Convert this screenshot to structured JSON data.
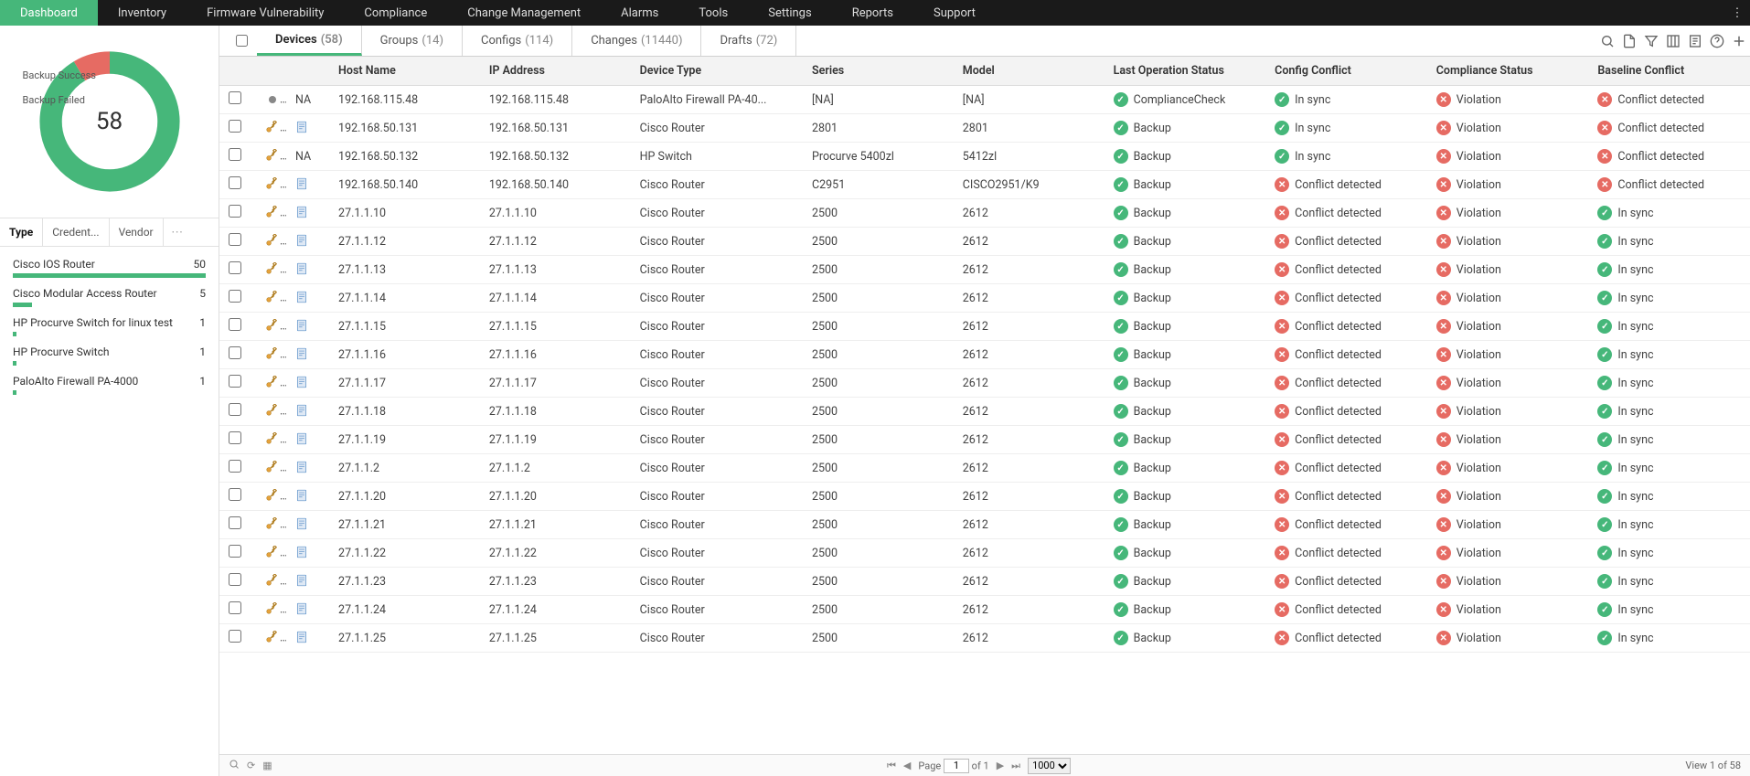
{
  "nav": {
    "items": [
      "Dashboard",
      "Inventory",
      "Firmware Vulnerability",
      "Compliance",
      "Change Management",
      "Alarms",
      "Tools",
      "Settings",
      "Reports",
      "Support"
    ],
    "active": 0
  },
  "chart_data": {
    "type": "pie",
    "title": "",
    "categories": [
      "Backup Success",
      "Backup Failed"
    ],
    "values": [
      53,
      5
    ],
    "colors": [
      "#46b77a",
      "#e66b63"
    ],
    "center_label": "58"
  },
  "sideTabs": {
    "items": [
      "Type",
      "Credent...",
      "Vendor"
    ],
    "active": 0
  },
  "typeList": [
    {
      "label": "Cisco IOS Router",
      "count": 50,
      "pct": 100
    },
    {
      "label": "Cisco Modular Access Router",
      "count": 5,
      "pct": 10
    },
    {
      "label": "HP Procurve Switch for linux test",
      "count": 1,
      "pct": 2
    },
    {
      "label": "HP Procurve Switch",
      "count": 1,
      "pct": 2
    },
    {
      "label": "PaloAlto Firewall PA-4000",
      "count": 1,
      "pct": 2
    }
  ],
  "tabs": [
    {
      "label": "Devices",
      "count": "(58)",
      "active": true
    },
    {
      "label": "Groups",
      "count": "(14)"
    },
    {
      "label": "Configs",
      "count": "(114)"
    },
    {
      "label": "Changes",
      "count": "(11440)"
    },
    {
      "label": "Drafts",
      "count": "(72)"
    }
  ],
  "columns": [
    "",
    "",
    "",
    "Host Name",
    "IP Address",
    "Device Type",
    "Series",
    "Model",
    "Last Operation Status",
    "Config Conflict",
    "Compliance Status",
    "Baseline Conflict"
  ],
  "rows": [
    {
      "cred": "dash",
      "tmpl": "NA",
      "host": "192.168.115.48",
      "ip": "192.168.115.48",
      "type": "PaloAlto Firewall PA-40...",
      "series": "[NA]",
      "model": "[NA]",
      "op": {
        "ok": true,
        "text": "ComplianceCheck"
      },
      "cc": {
        "ok": true,
        "text": "In sync"
      },
      "cs": {
        "ok": false,
        "text": "Violation"
      },
      "bc": {
        "ok": false,
        "text": "Conflict detected"
      }
    },
    {
      "cred": "key",
      "tmpl": "doc",
      "host": "192.168.50.131",
      "ip": "192.168.50.131",
      "type": "Cisco Router",
      "series": "2801",
      "model": "2801",
      "op": {
        "ok": true,
        "text": "Backup"
      },
      "cc": {
        "ok": true,
        "text": "In sync"
      },
      "cs": {
        "ok": false,
        "text": "Violation"
      },
      "bc": {
        "ok": false,
        "text": "Conflict detected"
      }
    },
    {
      "cred": "key",
      "tmpl": "NA",
      "host": "192.168.50.132",
      "ip": "192.168.50.132",
      "type": "HP Switch",
      "series": "Procurve 5400zl",
      "model": "5412zl",
      "op": {
        "ok": true,
        "text": "Backup"
      },
      "cc": {
        "ok": true,
        "text": "In sync"
      },
      "cs": {
        "ok": false,
        "text": "Violation"
      },
      "bc": {
        "ok": false,
        "text": "Conflict detected"
      }
    },
    {
      "cred": "key",
      "tmpl": "doc",
      "host": "192.168.50.140",
      "ip": "192.168.50.140",
      "type": "Cisco Router",
      "series": "C2951",
      "model": "CISCO2951/K9",
      "op": {
        "ok": true,
        "text": "Backup"
      },
      "cc": {
        "ok": false,
        "text": "Conflict detected"
      },
      "cs": {
        "ok": false,
        "text": "Violation"
      },
      "bc": {
        "ok": false,
        "text": "Conflict detected"
      }
    },
    {
      "cred": "key",
      "tmpl": "doc",
      "host": "27.1.1.10",
      "ip": "27.1.1.10",
      "type": "Cisco Router",
      "series": "2500",
      "model": "2612",
      "op": {
        "ok": true,
        "text": "Backup"
      },
      "cc": {
        "ok": false,
        "text": "Conflict detected"
      },
      "cs": {
        "ok": false,
        "text": "Violation"
      },
      "bc": {
        "ok": true,
        "text": "In sync"
      }
    },
    {
      "cred": "key",
      "tmpl": "doc",
      "host": "27.1.1.12",
      "ip": "27.1.1.12",
      "type": "Cisco Router",
      "series": "2500",
      "model": "2612",
      "op": {
        "ok": true,
        "text": "Backup"
      },
      "cc": {
        "ok": false,
        "text": "Conflict detected"
      },
      "cs": {
        "ok": false,
        "text": "Violation"
      },
      "bc": {
        "ok": true,
        "text": "In sync"
      }
    },
    {
      "cred": "key",
      "tmpl": "doc",
      "host": "27.1.1.13",
      "ip": "27.1.1.13",
      "type": "Cisco Router",
      "series": "2500",
      "model": "2612",
      "op": {
        "ok": true,
        "text": "Backup"
      },
      "cc": {
        "ok": false,
        "text": "Conflict detected"
      },
      "cs": {
        "ok": false,
        "text": "Violation"
      },
      "bc": {
        "ok": true,
        "text": "In sync"
      }
    },
    {
      "cred": "key",
      "tmpl": "doc",
      "host": "27.1.1.14",
      "ip": "27.1.1.14",
      "type": "Cisco Router",
      "series": "2500",
      "model": "2612",
      "op": {
        "ok": true,
        "text": "Backup"
      },
      "cc": {
        "ok": false,
        "text": "Conflict detected"
      },
      "cs": {
        "ok": false,
        "text": "Violation"
      },
      "bc": {
        "ok": true,
        "text": "In sync"
      }
    },
    {
      "cred": "key",
      "tmpl": "doc",
      "host": "27.1.1.15",
      "ip": "27.1.1.15",
      "type": "Cisco Router",
      "series": "2500",
      "model": "2612",
      "op": {
        "ok": true,
        "text": "Backup"
      },
      "cc": {
        "ok": false,
        "text": "Conflict detected"
      },
      "cs": {
        "ok": false,
        "text": "Violation"
      },
      "bc": {
        "ok": true,
        "text": "In sync"
      }
    },
    {
      "cred": "key",
      "tmpl": "doc",
      "host": "27.1.1.16",
      "ip": "27.1.1.16",
      "type": "Cisco Router",
      "series": "2500",
      "model": "2612",
      "op": {
        "ok": true,
        "text": "Backup"
      },
      "cc": {
        "ok": false,
        "text": "Conflict detected"
      },
      "cs": {
        "ok": false,
        "text": "Violation"
      },
      "bc": {
        "ok": true,
        "text": "In sync"
      }
    },
    {
      "cred": "key",
      "tmpl": "doc",
      "host": "27.1.1.17",
      "ip": "27.1.1.17",
      "type": "Cisco Router",
      "series": "2500",
      "model": "2612",
      "op": {
        "ok": true,
        "text": "Backup"
      },
      "cc": {
        "ok": false,
        "text": "Conflict detected"
      },
      "cs": {
        "ok": false,
        "text": "Violation"
      },
      "bc": {
        "ok": true,
        "text": "In sync"
      }
    },
    {
      "cred": "key",
      "tmpl": "doc",
      "host": "27.1.1.18",
      "ip": "27.1.1.18",
      "type": "Cisco Router",
      "series": "2500",
      "model": "2612",
      "op": {
        "ok": true,
        "text": "Backup"
      },
      "cc": {
        "ok": false,
        "text": "Conflict detected"
      },
      "cs": {
        "ok": false,
        "text": "Violation"
      },
      "bc": {
        "ok": true,
        "text": "In sync"
      }
    },
    {
      "cred": "key",
      "tmpl": "doc",
      "host": "27.1.1.19",
      "ip": "27.1.1.19",
      "type": "Cisco Router",
      "series": "2500",
      "model": "2612",
      "op": {
        "ok": true,
        "text": "Backup"
      },
      "cc": {
        "ok": false,
        "text": "Conflict detected"
      },
      "cs": {
        "ok": false,
        "text": "Violation"
      },
      "bc": {
        "ok": true,
        "text": "In sync"
      }
    },
    {
      "cred": "key",
      "tmpl": "doc",
      "host": "27.1.1.2",
      "ip": "27.1.1.2",
      "type": "Cisco Router",
      "series": "2500",
      "model": "2612",
      "op": {
        "ok": true,
        "text": "Backup"
      },
      "cc": {
        "ok": false,
        "text": "Conflict detected"
      },
      "cs": {
        "ok": false,
        "text": "Violation"
      },
      "bc": {
        "ok": true,
        "text": "In sync"
      }
    },
    {
      "cred": "key",
      "tmpl": "doc",
      "host": "27.1.1.20",
      "ip": "27.1.1.20",
      "type": "Cisco Router",
      "series": "2500",
      "model": "2612",
      "op": {
        "ok": true,
        "text": "Backup"
      },
      "cc": {
        "ok": false,
        "text": "Conflict detected"
      },
      "cs": {
        "ok": false,
        "text": "Violation"
      },
      "bc": {
        "ok": true,
        "text": "In sync"
      }
    },
    {
      "cred": "key",
      "tmpl": "doc",
      "host": "27.1.1.21",
      "ip": "27.1.1.21",
      "type": "Cisco Router",
      "series": "2500",
      "model": "2612",
      "op": {
        "ok": true,
        "text": "Backup"
      },
      "cc": {
        "ok": false,
        "text": "Conflict detected"
      },
      "cs": {
        "ok": false,
        "text": "Violation"
      },
      "bc": {
        "ok": true,
        "text": "In sync"
      }
    },
    {
      "cred": "key",
      "tmpl": "doc",
      "host": "27.1.1.22",
      "ip": "27.1.1.22",
      "type": "Cisco Router",
      "series": "2500",
      "model": "2612",
      "op": {
        "ok": true,
        "text": "Backup"
      },
      "cc": {
        "ok": false,
        "text": "Conflict detected"
      },
      "cs": {
        "ok": false,
        "text": "Violation"
      },
      "bc": {
        "ok": true,
        "text": "In sync"
      }
    },
    {
      "cred": "key",
      "tmpl": "doc",
      "host": "27.1.1.23",
      "ip": "27.1.1.23",
      "type": "Cisco Router",
      "series": "2500",
      "model": "2612",
      "op": {
        "ok": true,
        "text": "Backup"
      },
      "cc": {
        "ok": false,
        "text": "Conflict detected"
      },
      "cs": {
        "ok": false,
        "text": "Violation"
      },
      "bc": {
        "ok": true,
        "text": "In sync"
      }
    },
    {
      "cred": "key",
      "tmpl": "doc",
      "host": "27.1.1.24",
      "ip": "27.1.1.24",
      "type": "Cisco Router",
      "series": "2500",
      "model": "2612",
      "op": {
        "ok": true,
        "text": "Backup"
      },
      "cc": {
        "ok": false,
        "text": "Conflict detected"
      },
      "cs": {
        "ok": false,
        "text": "Violation"
      },
      "bc": {
        "ok": true,
        "text": "In sync"
      }
    },
    {
      "cred": "key",
      "tmpl": "doc",
      "host": "27.1.1.25",
      "ip": "27.1.1.25",
      "type": "Cisco Router",
      "series": "2500",
      "model": "2612",
      "op": {
        "ok": true,
        "text": "Backup"
      },
      "cc": {
        "ok": false,
        "text": "Conflict detected"
      },
      "cs": {
        "ok": false,
        "text": "Violation"
      },
      "bc": {
        "ok": true,
        "text": "In sync"
      }
    }
  ],
  "footer": {
    "pageLabel": "Page",
    "page": "1",
    "of": "of 1",
    "perPage": "1000",
    "viewText": "View 1 of 58"
  }
}
